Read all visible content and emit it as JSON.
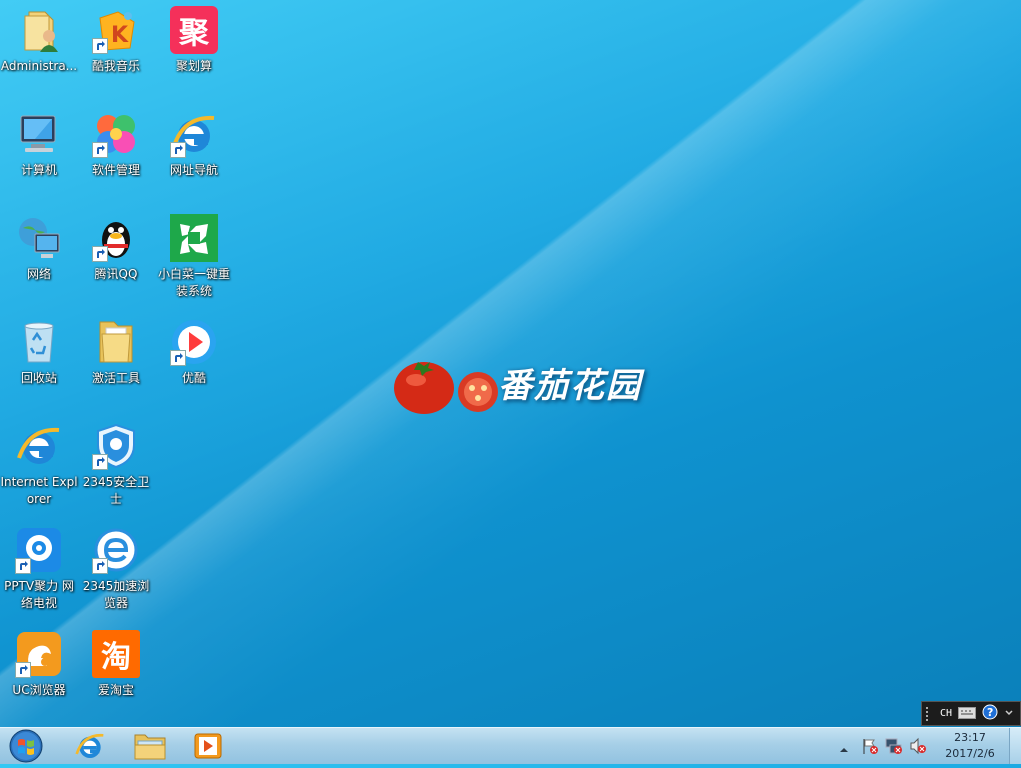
{
  "desktop": {
    "icons": [
      {
        "key": "admin",
        "label": "Administra..."
      },
      {
        "key": "kuwo",
        "label": "酷我音乐"
      },
      {
        "key": "juhuasuan",
        "label": "聚划算"
      },
      {
        "key": "computer",
        "label": "计算机"
      },
      {
        "key": "software",
        "label": "软件管理"
      },
      {
        "key": "webnav",
        "label": "网址导航"
      },
      {
        "key": "network",
        "label": "网络"
      },
      {
        "key": "qq",
        "label": "腾讯QQ"
      },
      {
        "key": "xiaobaicai",
        "label": "小白菜一键重装系统"
      },
      {
        "key": "recycle",
        "label": "回收站"
      },
      {
        "key": "activate",
        "label": "激活工具"
      },
      {
        "key": "youku",
        "label": "优酷"
      },
      {
        "key": "ie",
        "label": "Internet Explorer"
      },
      {
        "key": "guard2345",
        "label": "2345安全卫士"
      },
      {
        "key": "pptv",
        "label": "PPTV聚力 网络电视"
      },
      {
        "key": "browser2345",
        "label": "2345加速浏览器"
      },
      {
        "key": "uc",
        "label": "UC浏览器"
      },
      {
        "key": "taobao",
        "label": "爱淘宝"
      }
    ],
    "juhuasuan_glyph": "聚",
    "taobao_glyph": "淘"
  },
  "wallpaper": {
    "logo_text": "番茄花园"
  },
  "language_bar": {
    "lang": "CH"
  },
  "taskbar": {
    "apps": [
      "start-orb-icon",
      "internet-explorer-icon",
      "file-explorer-icon",
      "media-player-icon"
    ]
  },
  "clock": {
    "time": "23:17",
    "date": "2017/2/6"
  },
  "colors": {
    "desktop_bg": "#1aa8e2",
    "taskbar_bg": "#a6cfe7"
  }
}
